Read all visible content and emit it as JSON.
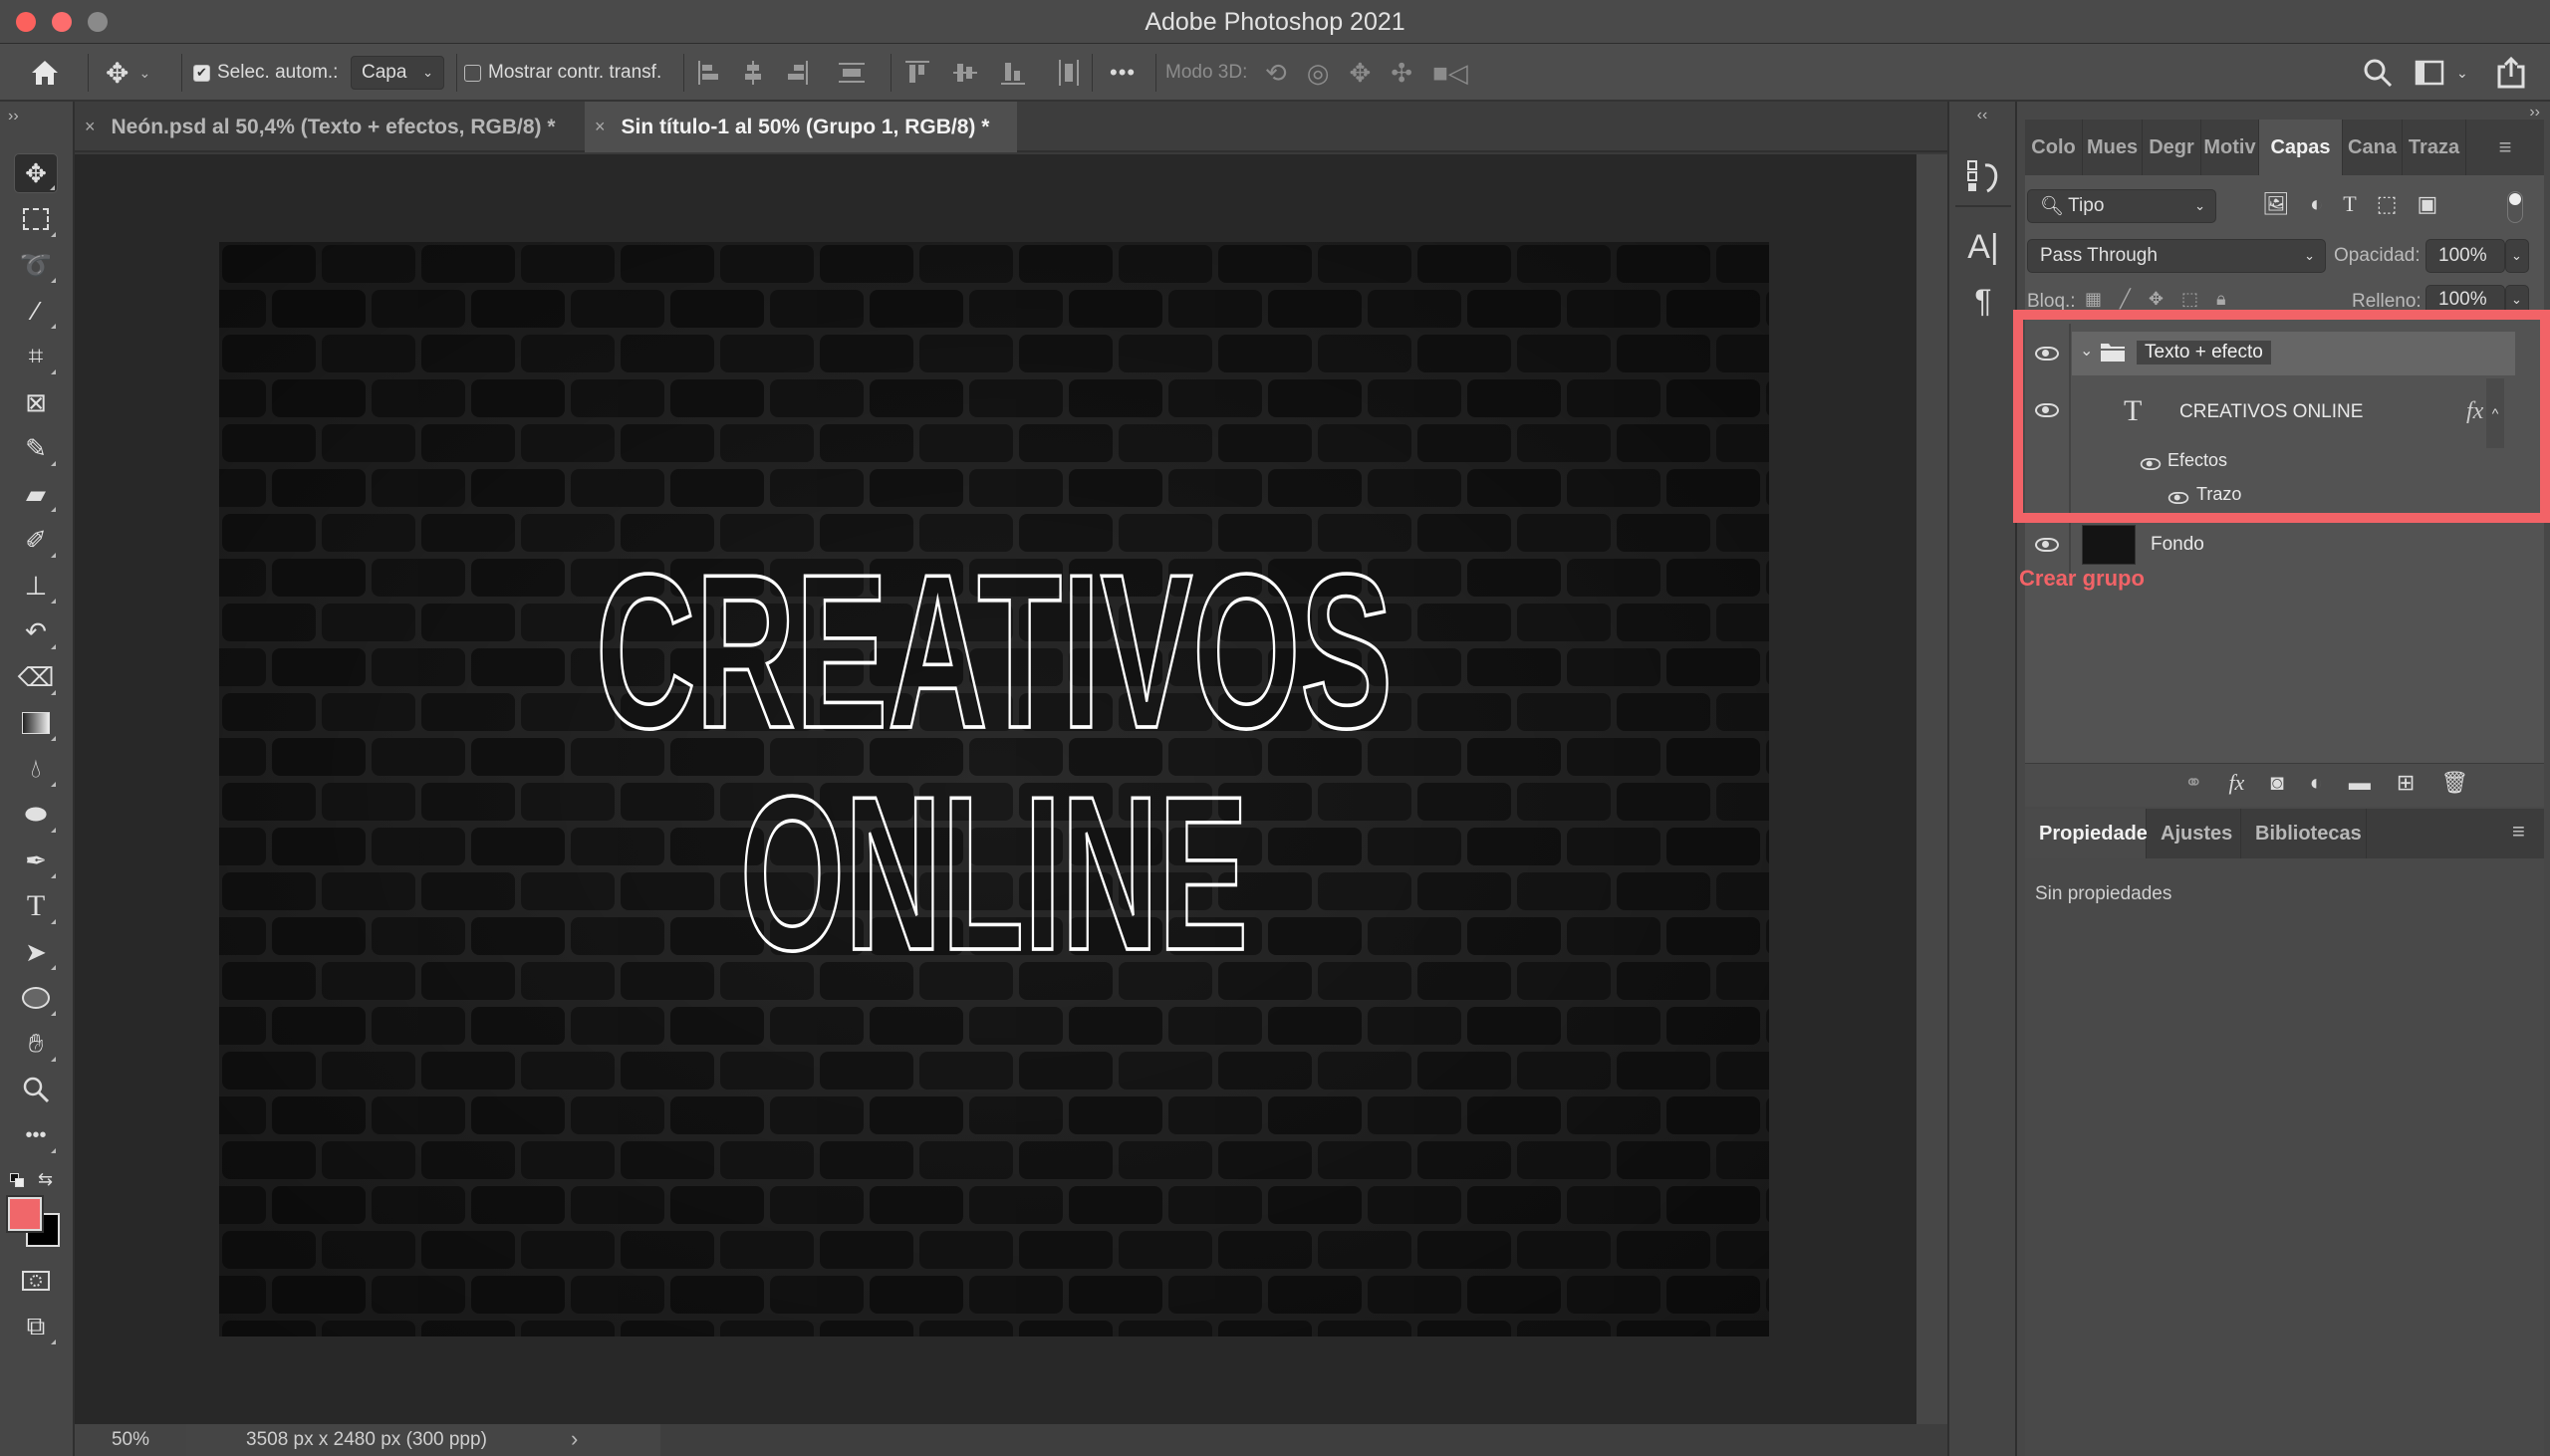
{
  "window": {
    "title": "Adobe Photoshop 2021",
    "traffic_lights": {
      "close": "#fc615d",
      "minimize": "#fd6d6d",
      "zoom": "#8a8a8a"
    }
  },
  "options_bar": {
    "home_icon": "home-icon",
    "move_tool_icon": "move-icon",
    "auto_select_checked": true,
    "auto_select_label": "Selec. autom.:",
    "auto_select_target": "Capa",
    "show_transform_checked": false,
    "show_transform_label": "Mostrar contr. transf.",
    "more_label": "•••",
    "mode_3d_label": "Modo 3D:",
    "align_icons": [
      "align-left-icon",
      "align-hcenter-icon",
      "align-right-icon",
      "distribute-vertical-icon",
      "align-top-icon",
      "align-vcenter-icon",
      "align-bottom-icon",
      "distribute-horizontal-icon"
    ],
    "mode_3d_icons": [
      "orbit-3d-icon",
      "roll-3d-icon",
      "drag-3d-icon",
      "slide-3d-icon",
      "camera-3d-icon"
    ],
    "right_icons": [
      "search-icon",
      "workspace-icon",
      "share-icon"
    ]
  },
  "document_tabs": [
    {
      "label": "Neón.psd al 50,4% (Texto + efectos, RGB/8) *",
      "active": false
    },
    {
      "label": "Sin título-1 al 50% (Grupo 1, RGB/8) *",
      "active": true
    }
  ],
  "tools": [
    "move",
    "rectangular-marquee",
    "object-selection",
    "magic-wand",
    "crop",
    "frame",
    "eyedropper",
    "healing-brush",
    "brush",
    "clone-stamp",
    "history-brush",
    "eraser",
    "gradient",
    "blur",
    "sponge",
    "pen",
    "type",
    "path-selection",
    "ellipse",
    "hand",
    "zoom",
    "more"
  ],
  "colors": {
    "foreground": "#f0676a",
    "background": "#000000",
    "accent": "#f26367"
  },
  "canvas": {
    "line1": "CREATIVOS",
    "line2": "ONLINE"
  },
  "status_bar": {
    "zoom": "50%",
    "doc_info": "3508 px x 2480 px (300 ppp)",
    "arrow": "›"
  },
  "panel_strip": {
    "collapse_label": "‹‹",
    "expand_label": "››"
  },
  "layers_panel": {
    "tabs": [
      {
        "label": "Color",
        "active": false
      },
      {
        "label": "Muestras",
        "active": false
      },
      {
        "label": "Degradados",
        "active": false
      },
      {
        "label": "Motivos",
        "active": false
      },
      {
        "label": "Capas",
        "active": true
      },
      {
        "label": "Canales",
        "active": false
      },
      {
        "label": "Trazados",
        "active": false
      }
    ],
    "tabs_display": [
      "Colo",
      "Mues",
      "Degr",
      "Motiv",
      "Capas",
      "Cana",
      "Traza"
    ],
    "filter_label": "Tipo",
    "blend_mode": "Pass Through",
    "opacity_label": "Opacidad:",
    "opacity_value": "100%",
    "lock_label": "Bloq.:",
    "fill_label": "Relleno:",
    "fill_value": "100%",
    "layers": [
      {
        "name": "Texto + efecto",
        "type": "group",
        "visible": true,
        "expanded": true
      },
      {
        "name": "CREATIVOS  ONLINE",
        "type": "text",
        "visible": true,
        "fx": "fx"
      },
      {
        "name": "Efectos",
        "type": "effects",
        "visible": true
      },
      {
        "name": "Trazo",
        "type": "effect",
        "visible": true
      },
      {
        "name": "Fondo",
        "type": "pixel",
        "visible": true
      }
    ],
    "annotation": "Crear grupo",
    "bottom_icons": [
      "link-layers-icon",
      "fx-icon",
      "add-mask-icon",
      "adjustment-layer-icon",
      "new-group-icon",
      "new-layer-icon",
      "delete-layer-icon"
    ]
  },
  "properties_panel": {
    "tabs": [
      {
        "label": "Propiedades",
        "active": true
      },
      {
        "label": "Ajustes",
        "active": false
      },
      {
        "label": "Bibliotecas",
        "active": false
      }
    ],
    "empty_text": "Sin propiedades"
  }
}
